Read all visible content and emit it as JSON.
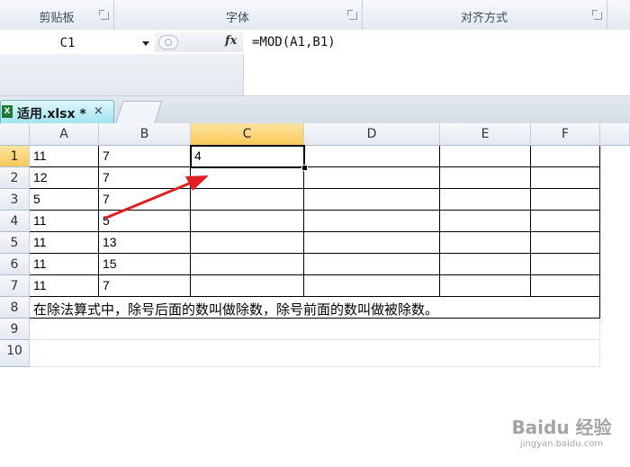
{
  "ribbon": {
    "groups": [
      {
        "label": "剪贴板"
      },
      {
        "label": "字体"
      },
      {
        "label": "对齐方式"
      }
    ]
  },
  "formula_bar": {
    "name_box": "C1",
    "fx_label": "fx",
    "formula": "=MOD(A1,B1)"
  },
  "sheet_tab": {
    "label": "适用.xlsx *",
    "close": "×"
  },
  "grid": {
    "column_headers": [
      "A",
      "B",
      "C",
      "D",
      "E",
      "F"
    ],
    "row_headers": [
      "1",
      "2",
      "3",
      "4",
      "5",
      "6",
      "7",
      "8",
      "9",
      "10"
    ],
    "rows": [
      [
        "11",
        "7",
        "4"
      ],
      [
        "12",
        "7",
        ""
      ],
      [
        "5",
        "7",
        ""
      ],
      [
        "11",
        "5",
        ""
      ],
      [
        "11",
        "13",
        ""
      ],
      [
        "11",
        "15",
        ""
      ],
      [
        "11",
        "7",
        ""
      ]
    ],
    "note": "在除法算式中，除号后面的数叫做除数，除号前面的数叫做被除数。",
    "selected_cell": "C1"
  },
  "watermark": {
    "text": "Baidu 经验",
    "sub": "jingyan.baidu.com"
  },
  "colors": {
    "selected_header": "#f8c95a",
    "arrow": "#e02020",
    "tab_active": "#9fe3ef"
  }
}
